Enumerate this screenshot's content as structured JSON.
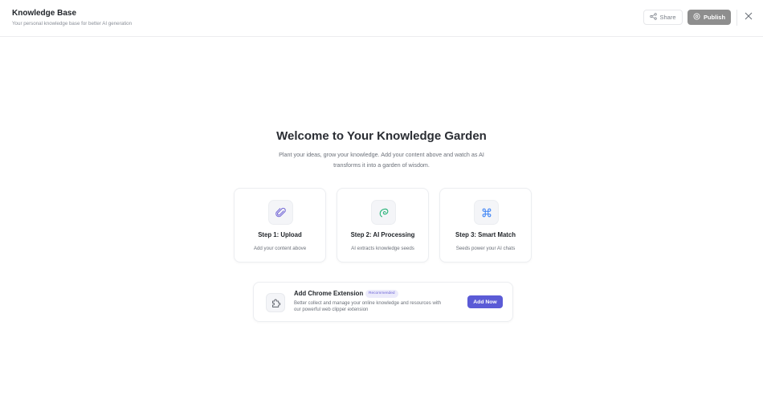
{
  "header": {
    "title": "Knowledge Base",
    "subtitle": "Your personal knowledge base for better AI generation",
    "share_label": "Share",
    "publish_label": "Publish"
  },
  "welcome": {
    "title": "Welcome to Your Knowledge Garden",
    "subtitle": "Plant your ideas, grow your knowledge. Add your content above and watch as AI transforms it into a garden of wisdom."
  },
  "steps": [
    {
      "title": "Step 1: Upload",
      "desc": "Add your content above",
      "icon": "paperclip-icon",
      "color": "#7b6fd8"
    },
    {
      "title": "Step 2: AI Processing",
      "desc": "AI extracts knowledge seeds",
      "icon": "seed-icon",
      "color": "#2eb67d"
    },
    {
      "title": "Step 3: Smart Match",
      "desc": "Seeds power your AI chats",
      "icon": "command-icon",
      "color": "#3b82f6"
    }
  ],
  "extension": {
    "title": "Add Chrome Extension",
    "badge": "Recommended",
    "desc": "Better collect and manage your online knowledge and resources with our powerful web clipper extension",
    "button_label": "Add Now",
    "icon": "puzzle-icon"
  },
  "colors": {
    "accent": "#5b5bd6",
    "publish_bg": "#8e8e8e",
    "badge_bg": "#ecebfb",
    "badge_text": "#6b63d6"
  }
}
